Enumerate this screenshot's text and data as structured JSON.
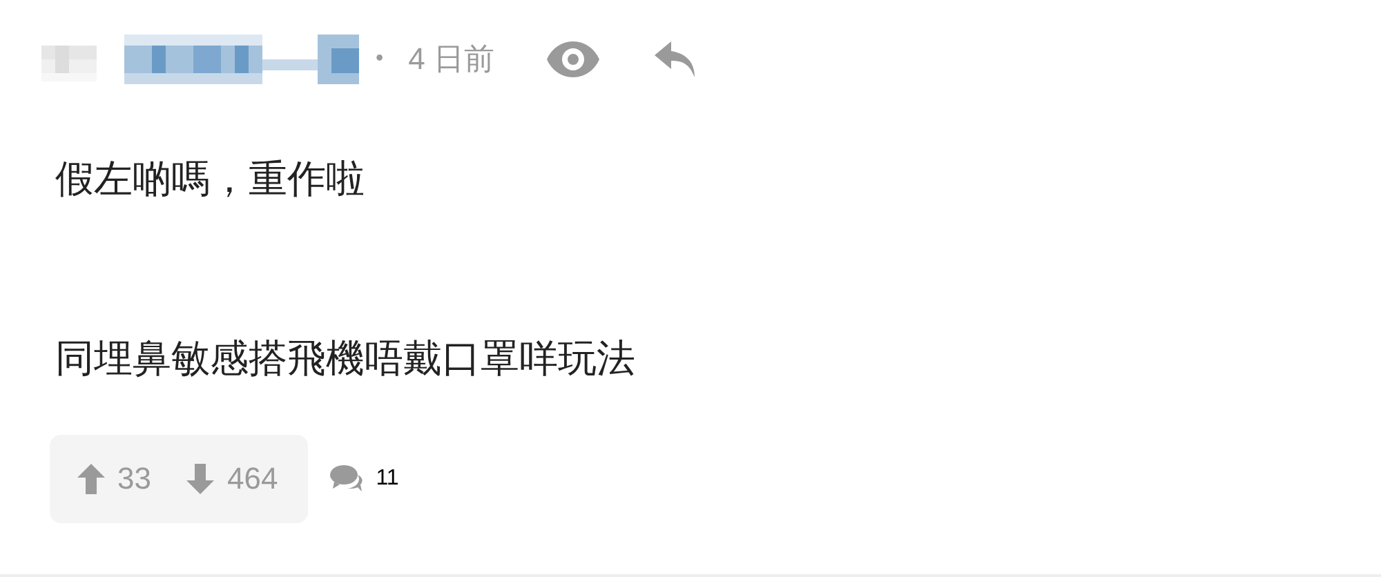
{
  "post": {
    "separator": "•",
    "time": "4 日前",
    "paragraphs": [
      "假左啲嗎，重作啦",
      "同埋鼻敏感搭飛機唔戴口罩咩玩法"
    ],
    "votes": {
      "up": "33",
      "down": "464"
    },
    "comments": "11"
  }
}
